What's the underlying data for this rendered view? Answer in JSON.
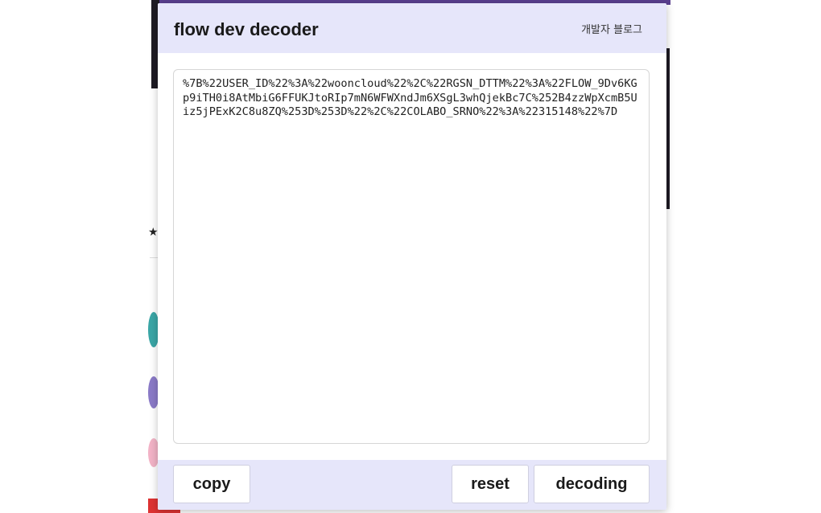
{
  "popup": {
    "title": "flow dev decoder",
    "blog_link": "개발자 블로그"
  },
  "editor": {
    "value": "%7B%22USER_ID%22%3A%22wooncloud%22%2C%22RGSN_DTTM%22%3A%22FLOW_9Dv6KGp9iTH0i8AtMbiG6FFUKJtoRIp7mN6WFWXndJm6XSgL3whQjekBc7C%252B4zzWpXcmB5Uiz5jPExK2C8u8ZQ%253D%253D%22%2C%22COLABO_SRNO%22%3A%22315148%22%7D"
  },
  "buttons": {
    "copy": "copy",
    "reset": "reset",
    "decoding": "decoding"
  },
  "colors": {
    "header_bg": "#e6e6fa",
    "footer_bg": "#e6e6fa",
    "accent_purple": "#5a3f8f"
  }
}
